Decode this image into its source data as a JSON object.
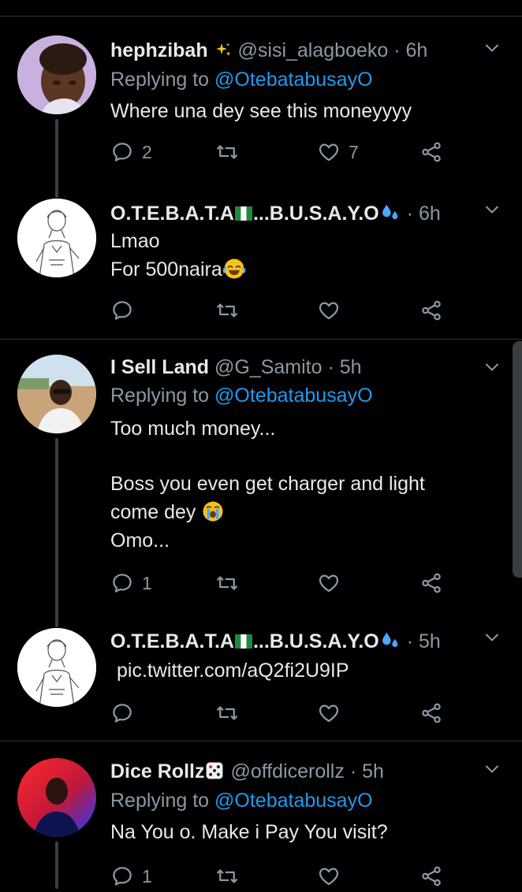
{
  "colors": {
    "background": "#000000",
    "text": "#e7e9ea",
    "muted": "#8b98a5",
    "link": "#1d9bf0",
    "divider": "#2f3336"
  },
  "tweets": [
    {
      "name": "hephzibah",
      "handle": "@sisi_alagboeko",
      "time": "· 6h",
      "replying_prefix": "Replying to",
      "replying_handle": "@OtebatabusayO",
      "text": "Where una dey see this moneyyyy",
      "reply_count": "2",
      "like_count": "7"
    },
    {
      "name_part1": "O.T.E.B.A.T.A",
      "name_part2": "...B.U.S.A.Y.O",
      "time": "· 6h",
      "line1": "Lmao",
      "line2": "For 500naira"
    },
    {
      "name": "I Sell Land",
      "handle": "@G_Samito",
      "time": "· 5h",
      "replying_prefix": "Replying to",
      "replying_handle": "@OtebatabusayO",
      "line1": "Too much money...",
      "line2": "Boss you even get charger and light",
      "line3": "come dey",
      "line4": "Omo...",
      "reply_count": "1"
    },
    {
      "name_part1": "O.T.E.B.A.T.A",
      "name_part2": "...B.U.S.A.Y.O",
      "time": "· 5h",
      "link": "pic.twitter.com/aQ2fi2U9IP"
    },
    {
      "name": "Dice Rollz",
      "handle": "@offdicerollz",
      "time": "· 5h",
      "replying_prefix": "Replying to",
      "replying_handle": "@OtebatabusayO",
      "text": "Na You o. Make i Pay You visit?",
      "reply_count": "1"
    }
  ]
}
